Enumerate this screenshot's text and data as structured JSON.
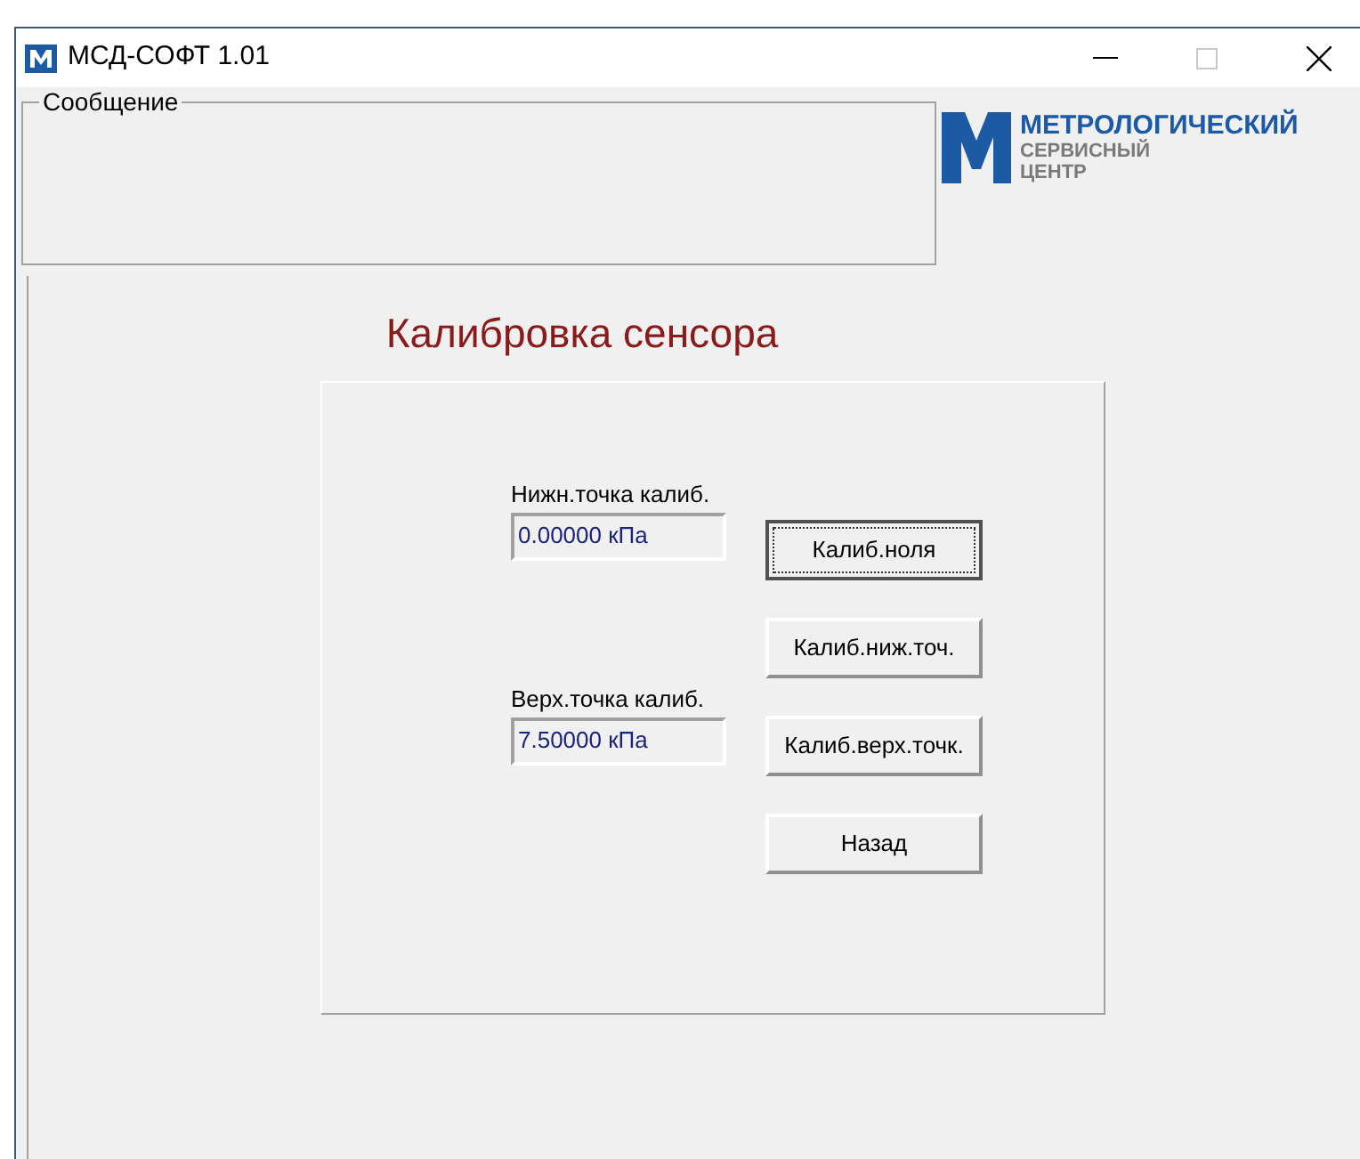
{
  "window": {
    "title": "МСД-СОФТ 1.01"
  },
  "message_group": {
    "label": "Сообщение"
  },
  "logo": {
    "line_1": "МЕТРОЛОГИЧЕСКИЙ",
    "line_2": "СЕРВИСНЫЙ",
    "line_3": "ЦЕНТР"
  },
  "heading": "Калибровка сенсора",
  "fields": [
    {
      "label": "Нижн.точка калиб.",
      "value": "0.00000 кПа"
    },
    {
      "label": "Верх.точка калиб.",
      "value": "7.50000 кПа"
    }
  ],
  "buttons": [
    {
      "label": "Калиб.ноля",
      "default": true
    },
    {
      "label": "Калиб.ниж.точ.",
      "default": false
    },
    {
      "label": "Калиб.верх.точк.",
      "default": false
    },
    {
      "label": "Назад",
      "default": false
    }
  ]
}
